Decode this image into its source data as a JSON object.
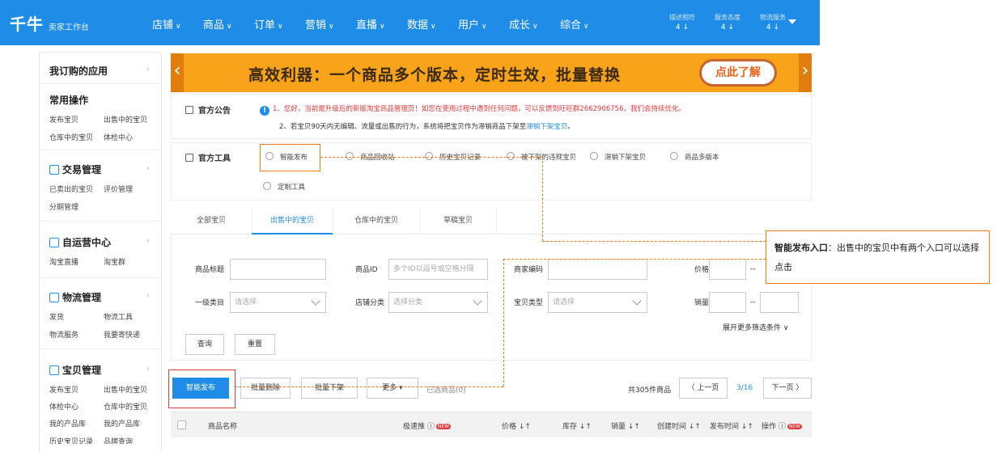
{
  "topbar": {
    "logo": "千牛",
    "logo_sub": "卖家工作台",
    "nav": [
      "店铺",
      "商品",
      "订单",
      "营销",
      "直播",
      "数据",
      "用户",
      "成长",
      "综合"
    ],
    "ratings": [
      {
        "label": "描述相符",
        "value": "4 ↓"
      },
      {
        "label": "服务态度",
        "value": "4 ↓"
      },
      {
        "label": "物流服务",
        "value": "4 ↓"
      }
    ]
  },
  "sidebar": {
    "apps_title": "我订购的应用",
    "common_title": "常用操作",
    "common_rows": [
      [
        "发布宝贝",
        "出售中的宝贝"
      ],
      [
        "仓库中的宝贝",
        "体检中心"
      ]
    ],
    "trade_title": "交易管理",
    "trade_rows": [
      [
        "已卖出的宝贝",
        "评价管理"
      ],
      [
        "分期管理",
        ""
      ]
    ],
    "ops_title": "自运营中心",
    "ops_rows": [
      [
        "淘宝直播",
        "淘宝群"
      ]
    ],
    "logistics_title": "物流管理",
    "logistics_rows": [
      [
        "发货",
        "物流工具"
      ],
      [
        "物流服务",
        "我要寄快递"
      ]
    ],
    "goods_title": "宝贝管理",
    "goods_rows": [
      [
        "发布宝贝",
        "出售中的宝贝"
      ],
      [
        "体检中心",
        "仓库中的宝贝"
      ],
      [
        "我的产品库",
        "我的产品库"
      ],
      [
        "历史宝贝记录",
        "品牌查询"
      ]
    ]
  },
  "banner": {
    "title": "高效利器：一个商品多个版本，定时生效，批量替换",
    "button": "点此了解"
  },
  "notice": {
    "label": "官方公告",
    "line1": "1、您好，当前是升级后的新版淘宝商品管理页！如您在使用过程中遇到任何问题，可以反馈到旺旺群2662906756，我们会持续优化。",
    "line2_prefix": "2、若宝贝90天内无编辑、流量或出售的行为，系统将把宝贝作为滞销商品下架至",
    "line2_link": "滞销下架宝贝",
    "line2_suffix": "。"
  },
  "tools": {
    "label": "官方工具",
    "items": [
      "智能发布",
      "商品回收站",
      "历史宝贝记录",
      "被下架的违规宝贝",
      "滞销下架宝贝",
      "商品多版本",
      "定制工具"
    ]
  },
  "tabs": [
    "全部宝贝",
    "出售中的宝贝",
    "仓库中的宝贝",
    "草稿宝贝"
  ],
  "filters": {
    "title_label": "商品标题",
    "id_label": "商品ID",
    "id_placeholder": "多个ID以逗号或空格分隔",
    "merchant_code_label": "商家编码",
    "price_label": "价格",
    "category_label": "一级类目",
    "category_placeholder": "请选择",
    "shop_cat_label": "店铺分类",
    "shop_cat_placeholder": "选择分类",
    "type_label": "宝贝类型",
    "type_placeholder": "请选择",
    "sales_label": "销量",
    "range_sep": "--",
    "more": "展开更多筛选条件 ∨",
    "query": "查询",
    "reset": "重置"
  },
  "actions": {
    "publish": "智能发布",
    "batch_delete": "批量删除",
    "batch_offshelf": "批量下架",
    "more": "更多 ▾",
    "selected": "已选商品(0)",
    "total": "共305件商品",
    "prev": "〈 上一页",
    "page": "3/16",
    "next": "下一页 〉"
  },
  "table_head": [
    "商品名称",
    "极速推",
    "价格 ↓↑",
    "库存 ↓↑",
    "销量 ↓↑",
    "创建时间 ↓↑",
    "发布时间 ↓↑",
    "操作"
  ],
  "new_badge": "NEW",
  "callout": {
    "bold": "智能发布入口",
    "text": "：出售中的宝贝中有两个入口可以选择点击"
  }
}
